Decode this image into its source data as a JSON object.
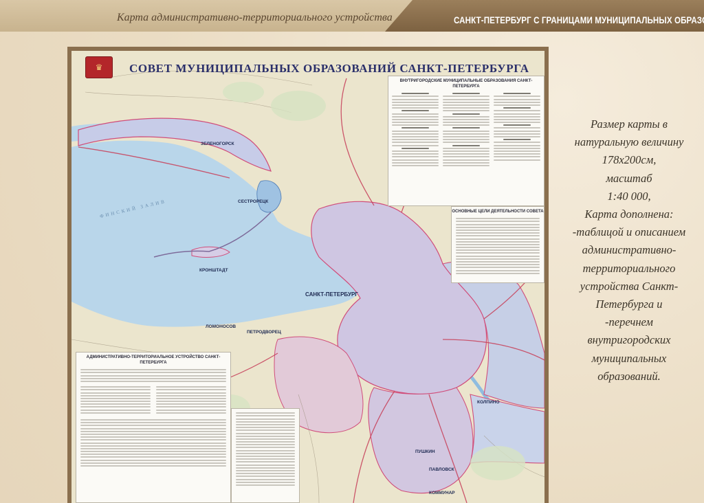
{
  "header": {
    "left_text": "Карта административно-территориального устройства",
    "right_text": "САНКТ-ПЕТЕРБУРГ С ГРАНИЦАМИ МУНИЦИПАЛЬНЫХ ОБРАЗОВАНИЙ"
  },
  "map": {
    "title": "СОВЕТ МУНИЦИПАЛЬНЫХ ОБРАЗОВАНИЙ САНКТ-ПЕТЕРБУРГА",
    "panels": {
      "districts_title": "ВНУТРИГОРОДСКИЕ МУНИЦИПАЛЬНЫЕ ОБРАЗОВАНИЯ САНКТ-ПЕТЕРБУРГА",
      "goals_title": "ОСНОВНЫЕ ЦЕЛИ ДЕЯТЕЛЬНОСТИ СОВЕТА",
      "admin_title": "АДМИНИСТРАТИВНО-ТЕРРИТОРИАЛЬНОЕ УСТРОЙСТВО САНКТ-ПЕТЕРБУРГА"
    },
    "places": [
      {
        "id": "zelenogorsk",
        "name": "ЗЕЛЕНОГОРСК"
      },
      {
        "id": "sestroretsk",
        "name": "СЕСТРОРЕЦК"
      },
      {
        "id": "kronshtadt",
        "name": "КРОНШТАДТ"
      },
      {
        "id": "spb",
        "name": "САНКТ-ПЕТЕРБУРГ"
      },
      {
        "id": "lomonosov",
        "name": "ЛОМОНОСОВ"
      },
      {
        "id": "petrodvorets",
        "name": "ПЕТРОДВОРЕЦ"
      },
      {
        "id": "kolpino",
        "name": "КОЛПИНО"
      },
      {
        "id": "pushkin",
        "name": "ПУШКИН"
      },
      {
        "id": "pavlovsk",
        "name": "ПАВЛОВСК"
      },
      {
        "id": "kommunar",
        "name": "КОММУНАР"
      },
      {
        "id": "gulf",
        "name": "ФИНСКИЙ ЗАЛИВ"
      }
    ]
  },
  "description": {
    "lines": [
      "Размер карты в",
      "натуральную величину",
      "178x200см,",
      "масштаб",
      "1:40 000,",
      "Карта дополнена:",
      "-таблицой и описанием",
      "административно-",
      "территориального",
      "устройства Санкт-",
      "Петербурга и",
      "-перечнем",
      "внутригородских",
      "муниципальных",
      "образований."
    ]
  },
  "colors": {
    "water": "#b9d6ea",
    "land": "#ece6cf",
    "city_district": "#c9c0dd",
    "border": "#d04d7a",
    "header_dark": "#8a6e4b"
  }
}
